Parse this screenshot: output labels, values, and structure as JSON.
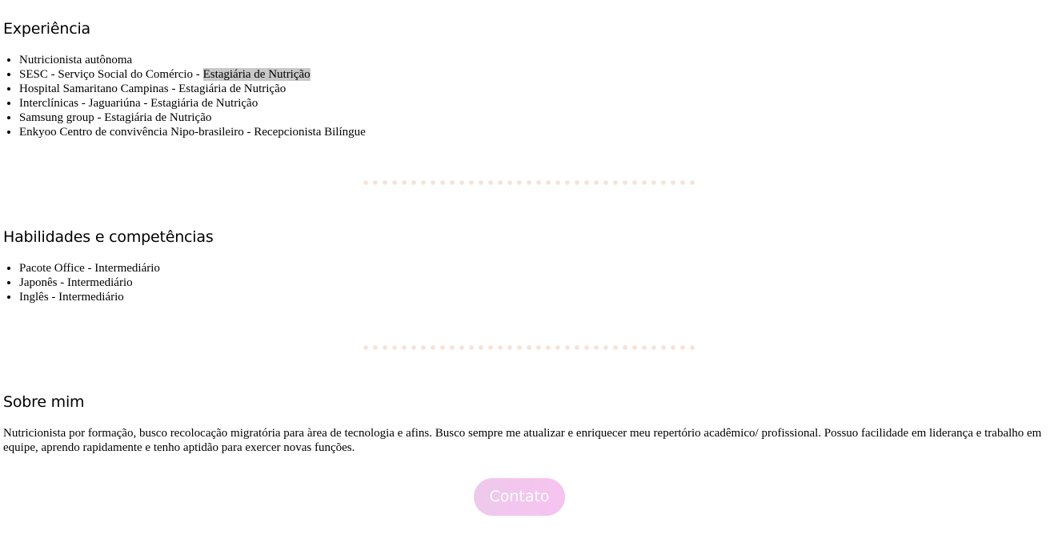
{
  "experience": {
    "title": "Experiência",
    "items": [
      {
        "text": "Nutricionista autônoma"
      },
      {
        "prefix": "SESC - Serviço Social do Comércio - ",
        "highlight": "Estagiária de Nutrição"
      },
      {
        "text": "Hospital Samaritano Campinas - Estagiária de Nutrição"
      },
      {
        "text": "Interclínicas - Jaguariúna - Estagiária de Nutrição"
      },
      {
        "text": "Samsung group - Estagiária de Nutrição"
      },
      {
        "text": "Enkyoo Centro de convivência Nipo-brasileiro - Recepcionista Bilíngue"
      }
    ]
  },
  "skills": {
    "title": "Habilidades e competências",
    "items": [
      "Pacote Office - Intermediário",
      "Japonês - Intermediário",
      "Inglês - Intermediário"
    ]
  },
  "about": {
    "title": "Sobre mim",
    "text": "Nutricionista por formação, busco recolocação migratória para àrea de tecnologia e afins. Busco sempre me atualizar e enriquecer meu repertório acadêmico/ profissional. Possuo facilidade em liderança e trabalho em equipe, aprendo rapidamente e tenho aptidão para exercer novas funções."
  },
  "contact": {
    "label": "Contato"
  },
  "colors": {
    "divider_dots": "#f6e3d8",
    "button_start": "#eec9ec",
    "button_end": "#f6c3f0",
    "highlight_bg": "#c8c8c8"
  }
}
